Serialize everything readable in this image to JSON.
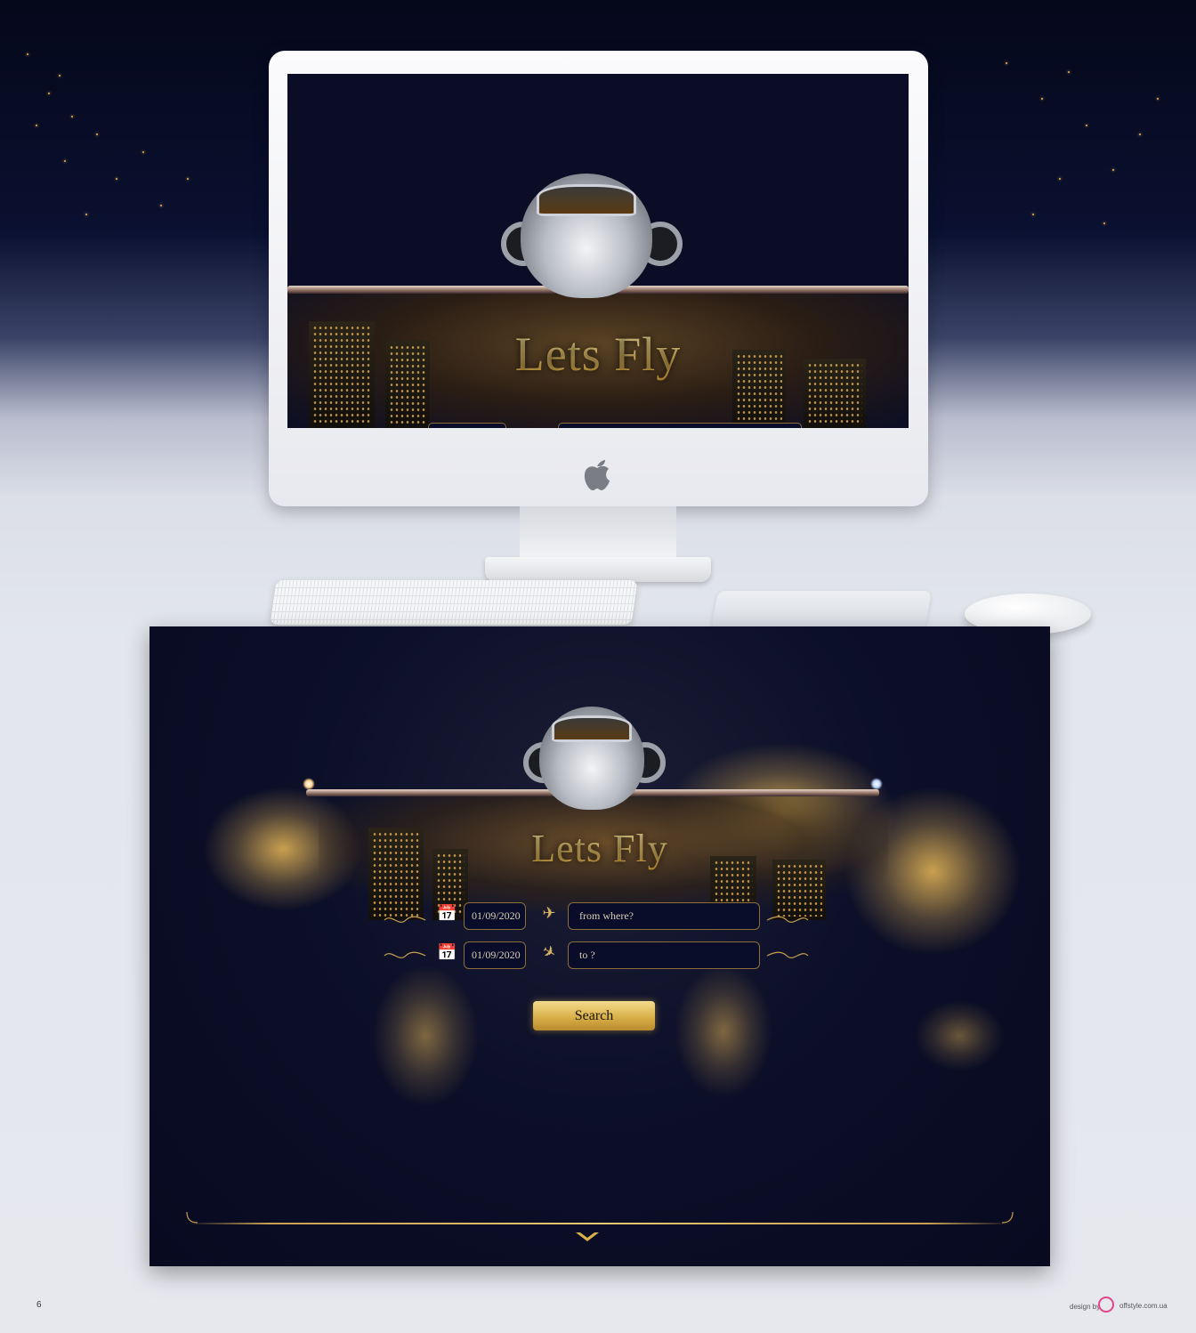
{
  "hero": {
    "title": "Lets Fly"
  },
  "form": {
    "rows": [
      {
        "date": "01/09/2020",
        "place": "from where?",
        "icon": "plane-depart-icon"
      },
      {
        "date": "01/09/2020",
        "place": "to ?",
        "icon": "plane-arrive-icon"
      }
    ],
    "search_label": "Search"
  },
  "page": {
    "number": "6",
    "credit_prefix": "design by",
    "credit_site": "offstyle.com.ua"
  },
  "colors": {
    "gold": "#d9b04a",
    "navy": "#0a0d2a",
    "field_border": "#8a6f3a"
  }
}
